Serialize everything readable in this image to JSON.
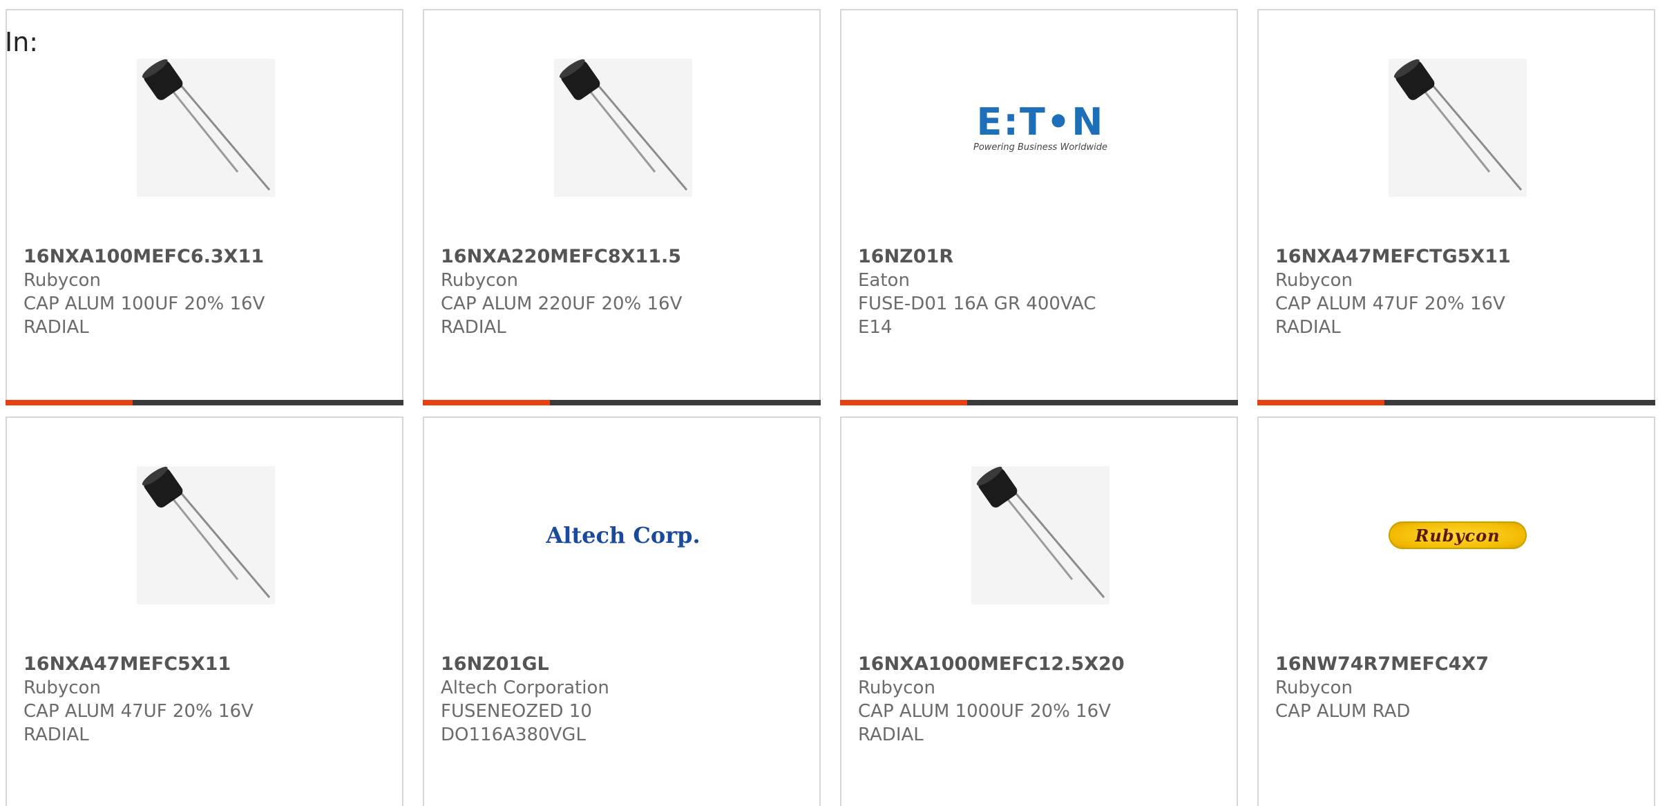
{
  "filter": {
    "label": "In:"
  },
  "products": [
    {
      "part": "16NXA100MEFC6.3X11",
      "manufacturer": "Rubycon",
      "description": "CAP ALUM 100UF 20% 16V RADIAL",
      "image": "capacitor-photo"
    },
    {
      "part": "16NXA220MEFC8X11.5",
      "manufacturer": "Rubycon",
      "description": "CAP ALUM 220UF 20% 16V RADIAL",
      "image": "capacitor-photo"
    },
    {
      "part": "16NZ01R",
      "manufacturer": "Eaton",
      "description": "FUSE-D01 16A GR 400VAC E14",
      "image": "eaton-logo"
    },
    {
      "part": "16NXA47MEFCTG5X11",
      "manufacturer": "Rubycon",
      "description": "CAP ALUM 47UF 20% 16V RADIAL",
      "image": "capacitor-photo"
    },
    {
      "part": "16NXA47MEFC5X11",
      "manufacturer": "Rubycon",
      "description": "CAP ALUM 47UF 20% 16V RADIAL",
      "image": "capacitor-photo"
    },
    {
      "part": "16NZ01GL",
      "manufacturer": "Altech Corporation",
      "description": "FUSENEOZED 10 DO116A380VGL",
      "image": "altech-logo"
    },
    {
      "part": "16NXA1000MEFC12.5X20",
      "manufacturer": "Rubycon",
      "description": "CAP ALUM 1000UF 20% 16V RADIAL",
      "image": "capacitor-photo"
    },
    {
      "part": "16NW74R7MEFC4X7",
      "manufacturer": "Rubycon",
      "description": "CAP ALUM RAD",
      "image": "rubycon-logo"
    }
  ],
  "logos": {
    "eaton": {
      "wordmark": "E:T•N",
      "tagline": "Powering Business Worldwide"
    },
    "altech": {
      "wordmark": "Altech Corp."
    },
    "rubycon": {
      "wordmark": "Rubycon"
    }
  },
  "colors": {
    "accent": "#e8410f",
    "bar": "#3a3a3a",
    "card_border": "#d6d6d6",
    "text_strong": "#555555",
    "text_muted": "#6b6b6b"
  }
}
